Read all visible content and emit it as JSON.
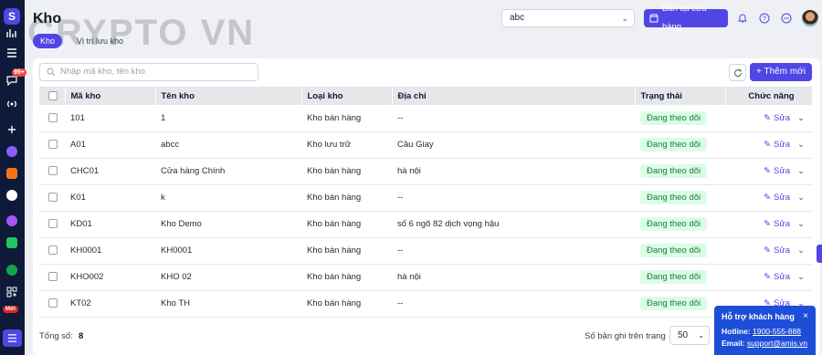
{
  "header": {
    "title": "Kho",
    "watermark": "CRYPTO VN",
    "tabs": [
      {
        "label": "Kho"
      },
      {
        "label": "Vị trí lưu kho"
      }
    ],
    "store_select": "abc",
    "sell_button": "Bán tại cửa hàng"
  },
  "rail": {
    "logo": "S",
    "badge": "99+",
    "new_label": "Mới"
  },
  "toolbar": {
    "search_placeholder": "Nhập mã kho, tên kho",
    "add_button": "+ Thêm mới"
  },
  "table": {
    "columns": [
      "Mã kho",
      "Tên kho",
      "Loại kho",
      "Địa chỉ",
      "Trạng thái",
      "Chức năng"
    ],
    "rows": [
      {
        "code": "101",
        "name": "1",
        "type": "Kho bán hàng",
        "address": "--",
        "status": "Đang theo dõi",
        "action": "Sửa"
      },
      {
        "code": "A01",
        "name": "abcc",
        "type": "Kho lưu trữ",
        "address": "Cầu Giay",
        "status": "Đang theo dõi",
        "action": "Sửa"
      },
      {
        "code": "CHC01",
        "name": "Cửa hàng Chính",
        "type": "Kho bán hàng",
        "address": "hà nội",
        "status": "Đang theo dõi",
        "action": "Sửa"
      },
      {
        "code": "K01",
        "name": "k",
        "type": "Kho bán hàng",
        "address": "--",
        "status": "Đang theo dõi",
        "action": "Sửa"
      },
      {
        "code": "KD01",
        "name": "Kho Demo",
        "type": "Kho bán hàng",
        "address": "số 6 ngõ 82 dịch vọng hậu",
        "status": "Đang theo dõi",
        "action": "Sửa"
      },
      {
        "code": "KH0001",
        "name": "KH0001",
        "type": "Kho bán hàng",
        "address": "--",
        "status": "Đang theo dõi",
        "action": "Sửa"
      },
      {
        "code": "KHO002",
        "name": "KHO 02",
        "type": "Kho bán hàng",
        "address": "hà nội",
        "status": "Đang theo dõi",
        "action": "Sửa"
      },
      {
        "code": "KT02",
        "name": "Kho TH",
        "type": "Kho bán hàng",
        "address": "--",
        "status": "Đang theo dõi",
        "action": "Sửa"
      }
    ]
  },
  "footer": {
    "total_label": "Tổng số:",
    "total_value": "8",
    "per_page_label": "Số bản ghi trên trang",
    "per_page_value": "50"
  },
  "support": {
    "title": "Hỗ trợ khách hàng",
    "close": "×",
    "hotline_label": "Hotline:",
    "hotline": "1900-555-888",
    "email_label": "Email:",
    "email": "support@amis.vn"
  },
  "colors": {
    "primary": "#4f46e5",
    "rail": "#0f1a3a",
    "status_bg": "#dcfce7",
    "status_text": "#15803d",
    "support": "#1d4ed8"
  }
}
